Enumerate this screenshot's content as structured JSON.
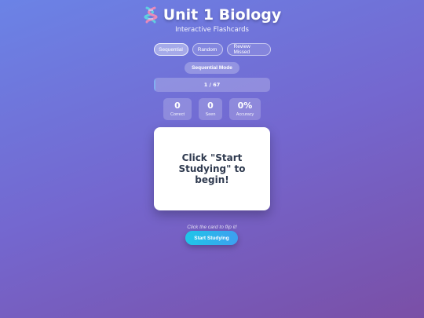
{
  "header": {
    "title": "Unit 1 Biology",
    "icon": "dna-icon",
    "subtitle": "Interactive Flashcards"
  },
  "modes": {
    "buttons": [
      "Sequential",
      "Random",
      "Review Missed"
    ],
    "active": "Sequential",
    "current_mode_label": "Sequential Mode"
  },
  "progress": {
    "text": "1 / 67",
    "current": 1,
    "total": 67
  },
  "stats": [
    {
      "value": "0",
      "label": "Correct"
    },
    {
      "value": "0",
      "label": "Seen"
    },
    {
      "value": "0%",
      "label": "Accuracy"
    }
  ],
  "card": {
    "text": "Click \"Start Studying\" to begin!"
  },
  "hint": "Click the card to flip it!",
  "start_button": "Start Studying",
  "colors": {
    "accent": "#1fc6e8",
    "card_text": "#2f3a4f"
  }
}
